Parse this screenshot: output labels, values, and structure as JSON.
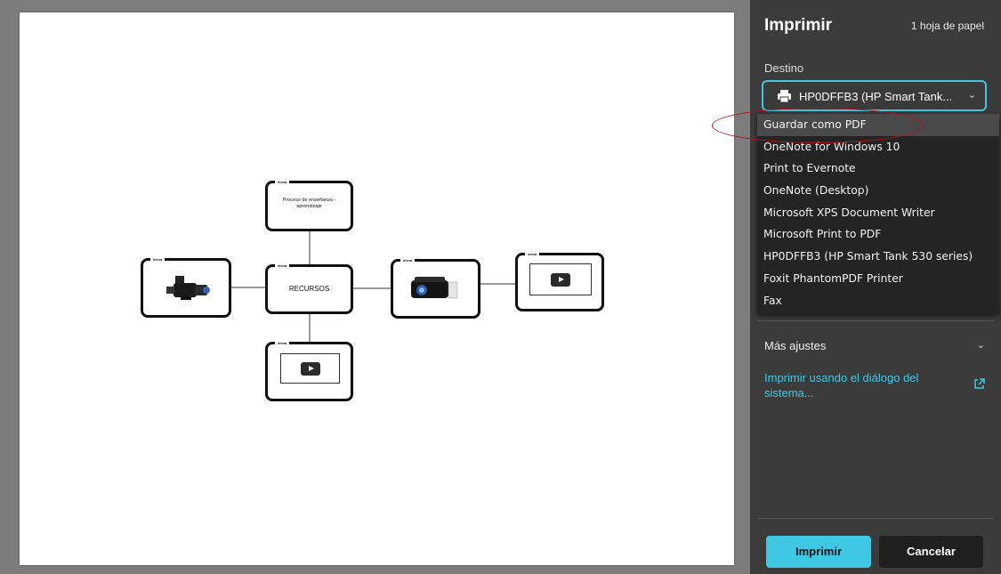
{
  "panel": {
    "title": "Imprimir",
    "sheets": "1 hoja de papel",
    "destination_label": "Destino",
    "destination_value": "HP0DFFB3 (HP Smart Tank...",
    "dropdown_options": [
      "Guardar como PDF",
      "OneNote for Windows 10",
      "Print to Evernote",
      "OneNote (Desktop)",
      "Microsoft XPS Document Writer",
      "Microsoft Print to PDF",
      "HP0DFFB3 (HP Smart Tank 530 series)",
      "Foxit PhantomPDF Printer",
      "Fax"
    ],
    "highlighted_option": "Guardar como PDF",
    "more_settings": "Más ajustes",
    "system_dialog_link": "Imprimir usando el diálogo del sistema...",
    "print_button": "Imprimir",
    "cancel_button": "Cancelar"
  },
  "diagram": {
    "node_tag": "elena",
    "top_node": "Proceso de enseñanza -aprendizaje",
    "center_node": "RECURSOS",
    "left_node_icon": "camcorder-image",
    "right_node_icon": "projector-image",
    "far_right_node_icon": "video-player-icon",
    "bottom_node_icon": "video-player-icon"
  },
  "colors": {
    "accent": "#3fc8e4",
    "panel_bg": "#3b3b3b",
    "dropdown_bg": "#242424",
    "annotation": "#b3121c"
  }
}
